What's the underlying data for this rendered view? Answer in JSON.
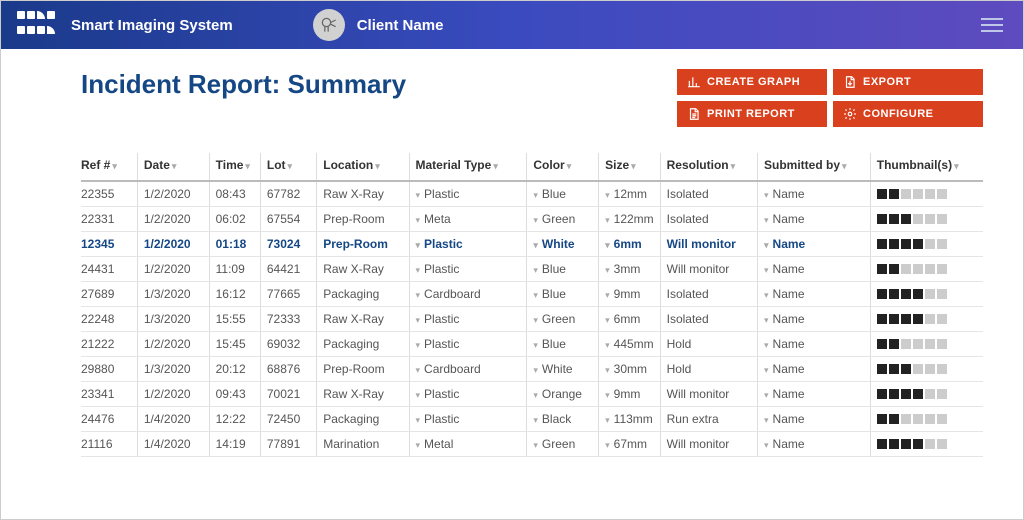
{
  "header": {
    "app_title": "Smart Imaging System",
    "client_name": "Client Name"
  },
  "page_title": "Incident Report: Summary",
  "actions": {
    "create_graph": "CREATE GRAPH",
    "export": "EXPORT",
    "print_report": "PRINT REPORT",
    "configure": "CONFIGURE"
  },
  "columns": {
    "ref": "Ref #",
    "date": "Date",
    "time": "Time",
    "lot": "Lot",
    "location": "Location",
    "material": "Material Type",
    "color": "Color",
    "size": "Size",
    "resolution": "Resolution",
    "submitted": "Submitted by",
    "thumbs": "Thumbnail(s)"
  },
  "rows": [
    {
      "ref": "22355",
      "date": "1/2/2020",
      "time": "08:43",
      "lot": "67782",
      "location": "Raw X-Ray",
      "material": "Plastic",
      "color": "Blue",
      "size": "12mm",
      "resolution": "Isolated",
      "submitted": "Name",
      "thumbs": 2,
      "selected": false
    },
    {
      "ref": "22331",
      "date": "1/2/2020",
      "time": "06:02",
      "lot": "67554",
      "location": "Prep-Room",
      "material": "Meta",
      "color": "Green",
      "size": "122mm",
      "resolution": "Isolated",
      "submitted": "Name",
      "thumbs": 3,
      "selected": false
    },
    {
      "ref": "12345",
      "date": "1/2/2020",
      "time": "01:18",
      "lot": "73024",
      "location": "Prep-Room",
      "material": "Plastic",
      "color": "White",
      "size": "6mm",
      "resolution": "Will monitor",
      "submitted": "Name",
      "thumbs": 4,
      "selected": true
    },
    {
      "ref": "24431",
      "date": "1/2/2020",
      "time": "11:09",
      "lot": "64421",
      "location": "Raw X-Ray",
      "material": "Plastic",
      "color": "Blue",
      "size": "3mm",
      "resolution": "Will monitor",
      "submitted": "Name",
      "thumbs": 2,
      "selected": false
    },
    {
      "ref": "27689",
      "date": "1/3/2020",
      "time": "16:12",
      "lot": "77665",
      "location": "Packaging",
      "material": "Cardboard",
      "color": "Blue",
      "size": "9mm",
      "resolution": "Isolated",
      "submitted": "Name",
      "thumbs": 4,
      "selected": false
    },
    {
      "ref": "22248",
      "date": "1/3/2020",
      "time": "15:55",
      "lot": "72333",
      "location": "Raw X-Ray",
      "material": "Plastic",
      "color": "Green",
      "size": "6mm",
      "resolution": "Isolated",
      "submitted": "Name",
      "thumbs": 4,
      "selected": false
    },
    {
      "ref": "21222",
      "date": "1/2/2020",
      "time": "15:45",
      "lot": "69032",
      "location": "Packaging",
      "material": "Plastic",
      "color": "Blue",
      "size": "445mm",
      "resolution": "Hold",
      "submitted": "Name",
      "thumbs": 2,
      "selected": false
    },
    {
      "ref": "29880",
      "date": "1/3/2020",
      "time": "20:12",
      "lot": "68876",
      "location": "Prep-Room",
      "material": "Cardboard",
      "color": "White",
      "size": "30mm",
      "resolution": "Hold",
      "submitted": "Name",
      "thumbs": 3,
      "selected": false
    },
    {
      "ref": "23341",
      "date": "1/2/2020",
      "time": "09:43",
      "lot": "70021",
      "location": "Raw X-Ray",
      "material": "Plastic",
      "color": "Orange",
      "size": "9mm",
      "resolution": "Will monitor",
      "submitted": "Name",
      "thumbs": 4,
      "selected": false
    },
    {
      "ref": "24476",
      "date": "1/4/2020",
      "time": "12:22",
      "lot": "72450",
      "location": "Packaging",
      "material": "Plastic",
      "color": "Black",
      "size": "113mm",
      "resolution": "Run extra",
      "submitted": "Name",
      "thumbs": 2,
      "selected": false
    },
    {
      "ref": "21116",
      "date": "1/4/2020",
      "time": "14:19",
      "lot": "77891",
      "location": "Marination",
      "material": "Metal",
      "color": "Green",
      "size": "67mm",
      "resolution": "Will monitor",
      "submitted": "Name",
      "thumbs": 4,
      "selected": false
    }
  ],
  "thumb_total": 6
}
